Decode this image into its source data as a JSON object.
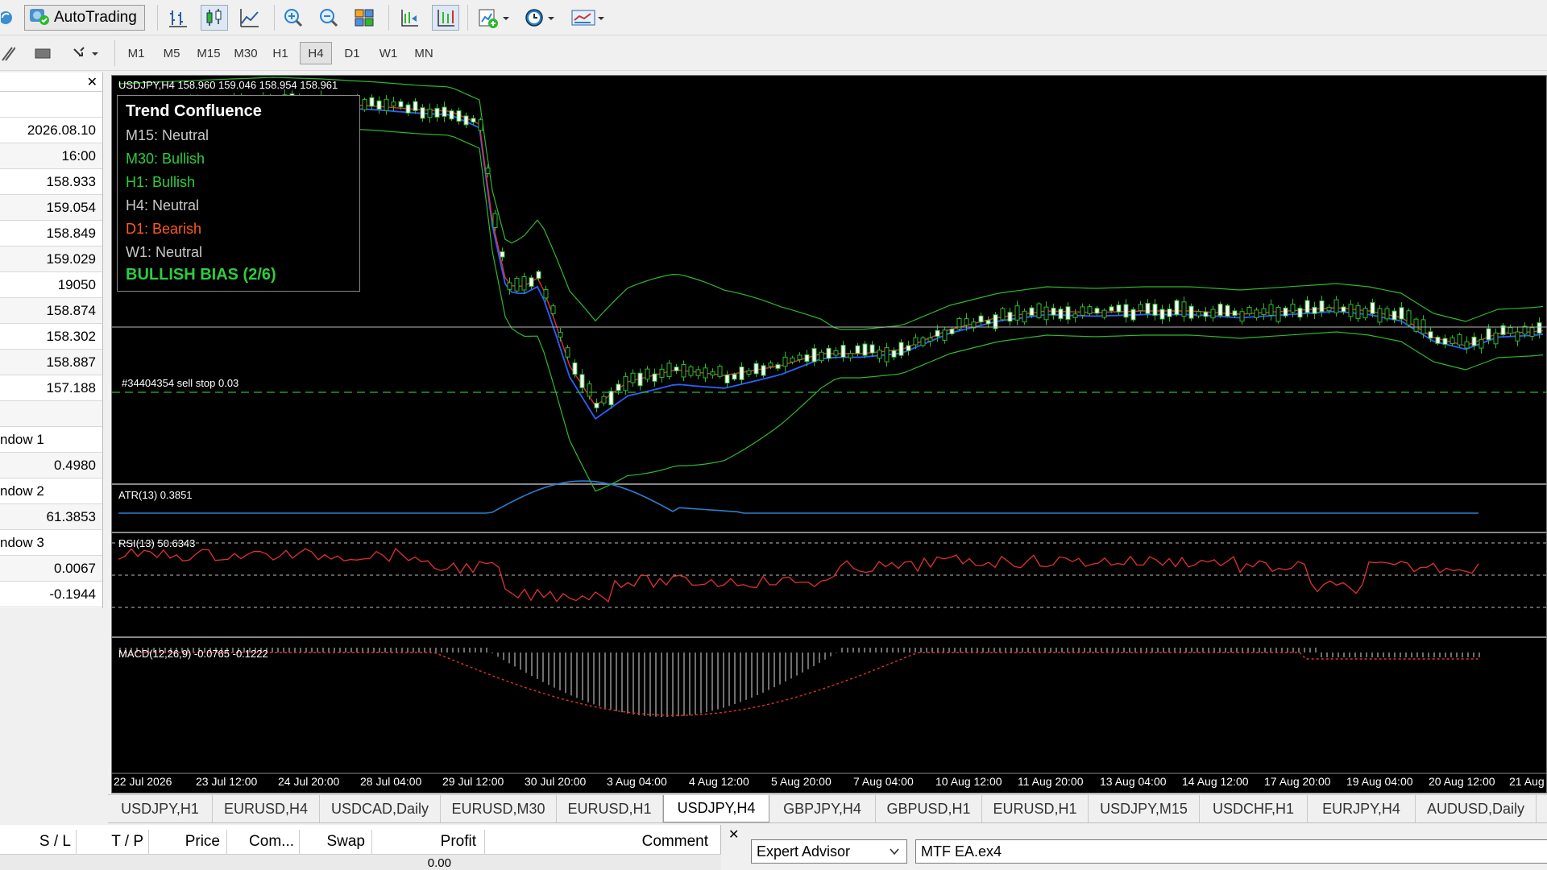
{
  "toolbar": {
    "autotrading_label": "AutoTrading",
    "timeframes": [
      "M1",
      "M5",
      "M15",
      "M30",
      "H1",
      "H4",
      "D1",
      "W1",
      "MN"
    ],
    "active_timeframe": "H4"
  },
  "data_window": {
    "rows": [
      "2026.08.10",
      "16:00",
      "158.933",
      "159.054",
      "158.849",
      "159.029",
      "19050",
      "158.874",
      "158.302",
      "158.887",
      "157.188"
    ],
    "groups": [
      {
        "label": "ndow 1",
        "values": [
          "0.4980"
        ]
      },
      {
        "label": "ndow 2",
        "values": [
          "61.3853"
        ]
      },
      {
        "label": "ndow 3",
        "values": [
          "0.0067",
          "-0.1944"
        ]
      }
    ]
  },
  "chart": {
    "symbol_label": "USDJPY,H4  158.960 159.046 158.954 158.961",
    "order_label": "#34404354 sell stop 0.03",
    "atr_label": "ATR(13) 0.3851",
    "rsi_label": "RSI(13) 50.6343",
    "macd_label": "MACD(12,26,9) -0.0765 -0.1222",
    "x_labels": [
      "22 Jul 2026",
      "23 Jul 12:00",
      "24 Jul 20:00",
      "28 Jul 04:00",
      "29 Jul 12:00",
      "30 Jul 20:00",
      "3 Aug 04:00",
      "4 Aug 12:00",
      "5 Aug 20:00",
      "7 Aug 04:00",
      "10 Aug 12:00",
      "11 Aug 20:00",
      "13 Aug 04:00",
      "14 Aug 12:00",
      "17 Aug 20:00",
      "19 Aug 04:00",
      "20 Aug 12:00",
      "21 Aug"
    ]
  },
  "trend_panel": {
    "title": "Trend Confluence",
    "rows": [
      {
        "text": "M15:  Neutral",
        "color": "#c8c8c8"
      },
      {
        "text": "M30:  Bullish",
        "color": "#2ecc40"
      },
      {
        "text": "H1:  Bullish",
        "color": "#2ecc40"
      },
      {
        "text": "H4:  Neutral",
        "color": "#c8c8c8"
      },
      {
        "text": "D1:  Bearish",
        "color": "#ff5a1f"
      },
      {
        "text": "W1:  Neutral",
        "color": "#c8c8c8"
      }
    ],
    "bias": "BULLISH BIAS (2/6)"
  },
  "tabs": [
    "USDJPY,H1",
    "EURUSD,H4",
    "USDCAD,Daily",
    "EURUSD,M30",
    "EURUSD,H1",
    "USDJPY,H4",
    "GBPJPY,H4",
    "GBPUSD,H1",
    "EURUSD,H1",
    "USDJPY,M15",
    "USDCHF,H1",
    "EURJPY,H4",
    "AUDUSD,Daily"
  ],
  "active_tab": "USDJPY,H4",
  "terminal": {
    "columns": [
      "S / L",
      "T / P",
      "Price",
      "Com...",
      "Swap",
      "Profit",
      "Comment"
    ],
    "profit_value": "0.00"
  },
  "tester": {
    "type_select": "Expert Advisor",
    "ea_select": "MTF EA.ex4"
  },
  "chart_data": {
    "type": "candlestick",
    "price_levels": {
      "current": 158.961,
      "sell_stop": 157.188
    }
  }
}
